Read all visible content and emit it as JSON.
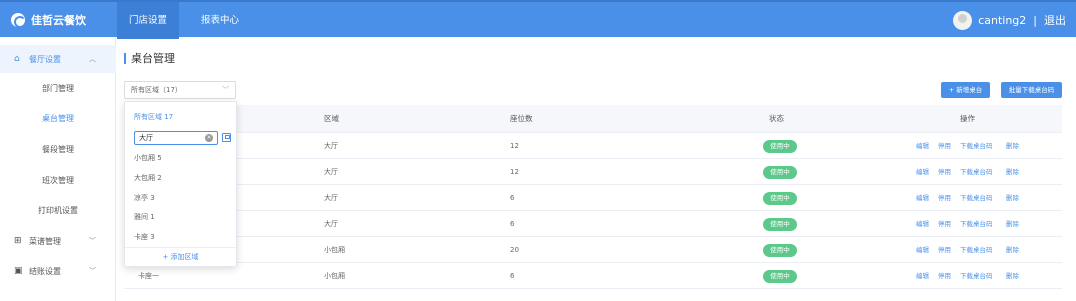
{
  "header": {
    "logo_text": "佳哲云餐饮",
    "tabs": [
      {
        "label": "门店设置",
        "active": true
      },
      {
        "label": "报表中心",
        "active": false
      }
    ],
    "username": "canting2",
    "separator": "|",
    "logout": "退出",
    "accent_color": "#4a90e8"
  },
  "sidebar": {
    "group_restaurant": {
      "label": "餐厅设置",
      "icon": "home-icon",
      "chevron": "^"
    },
    "items": [
      {
        "label": "部门管理",
        "active": false
      },
      {
        "label": "桌台管理",
        "active": true
      },
      {
        "label": "餐段管理",
        "active": false
      },
      {
        "label": "班次管理",
        "active": false
      },
      {
        "label": "打印机设置",
        "active": false
      }
    ],
    "group_dishes": {
      "label": "菜谱管理",
      "icon": "grid-icon",
      "chevron": "v"
    },
    "group_checkout": {
      "label": "结账设置",
      "icon": "checkout-icon",
      "chevron": "v"
    }
  },
  "main": {
    "title": "桌台管理",
    "area_select": {
      "value": "所有区域（17）",
      "chevron": "v"
    },
    "new_table_button": "+ 新增桌台",
    "batch_download_button": "批量下载桌台码",
    "table": {
      "columns": [
        "区域",
        "座位数",
        "状态",
        "操作"
      ],
      "rows": [
        {
          "name": "",
          "area": "大厅",
          "seats": "12",
          "status": "使用中"
        },
        {
          "name": "",
          "area": "大厅",
          "seats": "12",
          "status": "使用中"
        },
        {
          "name": "",
          "area": "大厅",
          "seats": "6",
          "status": "使用中"
        },
        {
          "name": "",
          "area": "大厅",
          "seats": "6",
          "status": "使用中"
        },
        {
          "name": "",
          "area": "小包厢",
          "seats": "20",
          "status": "使用中"
        },
        {
          "name": "卡座一",
          "area": "小包厢",
          "seats": "6",
          "status": "使用中"
        }
      ],
      "actions": [
        "编辑",
        "停用",
        "下载桌台码",
        "删除"
      ],
      "status_color": "#5cc98b"
    }
  },
  "dropdown": {
    "all_label": "所有区域 17",
    "search_value": "大厅",
    "clear_symbol": "×",
    "items": [
      {
        "label": "小包厢 5"
      },
      {
        "label": "大包厢 2"
      },
      {
        "label": "凉亭 3"
      },
      {
        "label": "雅间 1"
      },
      {
        "label": "卡座 3"
      }
    ],
    "add_label": "+ 添加区域"
  }
}
